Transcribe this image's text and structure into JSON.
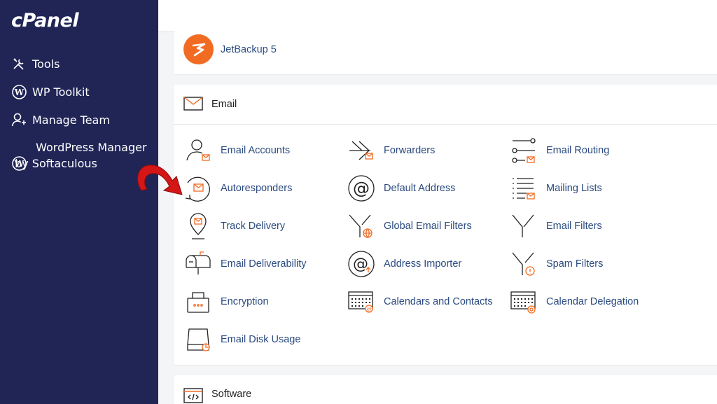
{
  "sidebar": {
    "logo": "cPanel",
    "items": [
      {
        "label": "Tools",
        "icon": "tools-icon"
      },
      {
        "label": "WP Toolkit",
        "icon": "wordpress-icon"
      },
      {
        "label": "Manage Team",
        "icon": "manage-team-icon"
      },
      {
        "label": "WordPress Manager\nby Softaculous",
        "icon": "wordpress-icon"
      }
    ]
  },
  "jetbackup": {
    "label": "JetBackup 5",
    "icon": "jetbackup-logo"
  },
  "email_section": {
    "title": "Email",
    "tools": [
      {
        "label": "Email Accounts",
        "icon": "email-accounts-icon"
      },
      {
        "label": "Forwarders",
        "icon": "forwarders-icon"
      },
      {
        "label": "Email Routing",
        "icon": "email-routing-icon"
      },
      {
        "label": "Autoresponders",
        "icon": "autoresponders-icon"
      },
      {
        "label": "Default Address",
        "icon": "default-address-icon"
      },
      {
        "label": "Mailing Lists",
        "icon": "mailing-lists-icon"
      },
      {
        "label": "Track Delivery",
        "icon": "track-delivery-icon"
      },
      {
        "label": "Global Email Filters",
        "icon": "global-email-filters-icon"
      },
      {
        "label": "Email Filters",
        "icon": "email-filters-icon"
      },
      {
        "label": "Email Deliverability",
        "icon": "email-deliverability-icon"
      },
      {
        "label": "Address Importer",
        "icon": "address-importer-icon"
      },
      {
        "label": "Spam Filters",
        "icon": "spam-filters-icon"
      },
      {
        "label": "Encryption",
        "icon": "encryption-icon"
      },
      {
        "label": "Calendars and Contacts",
        "icon": "calendars-contacts-icon"
      },
      {
        "label": "Calendar Delegation",
        "icon": "calendar-delegation-icon"
      },
      {
        "label": "Email Disk Usage",
        "icon": "email-disk-usage-icon"
      }
    ]
  },
  "software_section": {
    "title": "Software"
  },
  "colors": {
    "sidebar": "#202556",
    "accent": "#f26b22",
    "link": "#2a4a80",
    "arrow": "#d41616"
  }
}
